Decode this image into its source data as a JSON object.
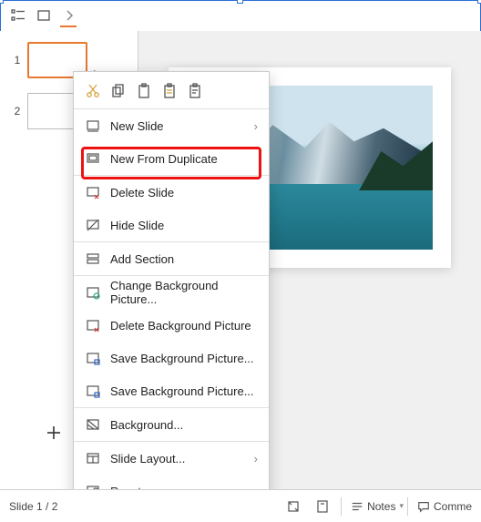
{
  "topbar": {
    "view_outline": "outline-view",
    "view_slide": "slide-view",
    "nav_next": "next"
  },
  "thumbs": [
    {
      "num": "1",
      "selected": true
    },
    {
      "num": "2",
      "selected": false
    }
  ],
  "context": {
    "clipboard": [
      "cut",
      "copy",
      "paste",
      "paste-special",
      "paste-unformatted"
    ],
    "items": [
      {
        "label": "New Slide",
        "arrow": true
      },
      {
        "label": "New From Duplicate",
        "highlight": true
      },
      {
        "label": "Delete Slide"
      },
      {
        "label": "Hide Slide"
      },
      {
        "label": "Add Section"
      },
      {
        "label": "Change Background Picture..."
      },
      {
        "label": "Delete Background Picture"
      },
      {
        "label": "Save Background Picture..."
      },
      {
        "label": "Save Background Picture..."
      },
      {
        "label": "Background..."
      },
      {
        "label": "Slide Layout...",
        "arrow": true
      },
      {
        "label": "Reset"
      }
    ]
  },
  "status": {
    "counter": "Slide 1 / 2",
    "notes": "Notes",
    "comments": "Comme"
  }
}
